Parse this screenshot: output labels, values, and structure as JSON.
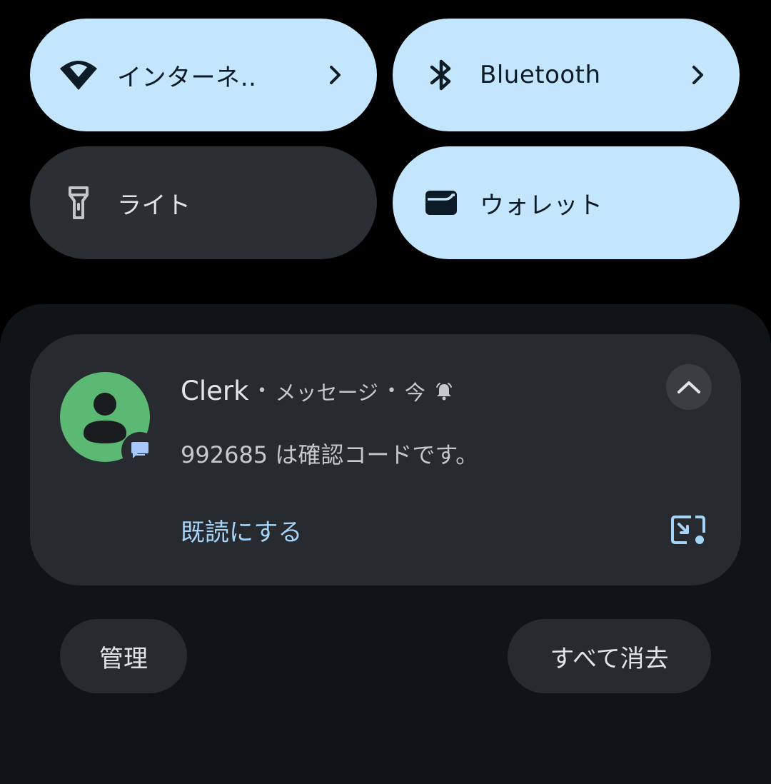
{
  "quick_settings": {
    "tiles": [
      {
        "label": "インターネ‥",
        "icon": "wifi-icon",
        "state": "on",
        "has_chevron": true
      },
      {
        "label": "Bluetooth",
        "icon": "bluetooth-icon",
        "state": "on",
        "has_chevron": true
      },
      {
        "label": "ライト",
        "icon": "flashlight-icon",
        "state": "off",
        "has_chevron": false
      },
      {
        "label": "ウォレット",
        "icon": "wallet-icon",
        "state": "on",
        "has_chevron": false
      }
    ]
  },
  "notification": {
    "app_name": "Clerk",
    "channel": "メッセージ",
    "time": "今",
    "separator": "•",
    "alert_icon": "bell-alert-icon",
    "avatar_icon": "person-avatar-icon",
    "badge_icon": "chat-bubble-icon",
    "body": "992685 は確認コードです。",
    "action_label": "既読にする",
    "collapse_icon": "chevron-up-icon",
    "bubble_icon": "open-bubble-icon"
  },
  "footer": {
    "manage_label": "管理",
    "clear_all_label": "すべて消去"
  },
  "colors": {
    "tile_on_bg": "#c4e6fc",
    "tile_off_bg": "#2b2e33",
    "shade_bg": "#111417",
    "card_bg": "#272a2f",
    "avatar_bg": "#5bb974",
    "accent_text": "#a6d4f7",
    "badge_icon": "#a8c7fa"
  }
}
